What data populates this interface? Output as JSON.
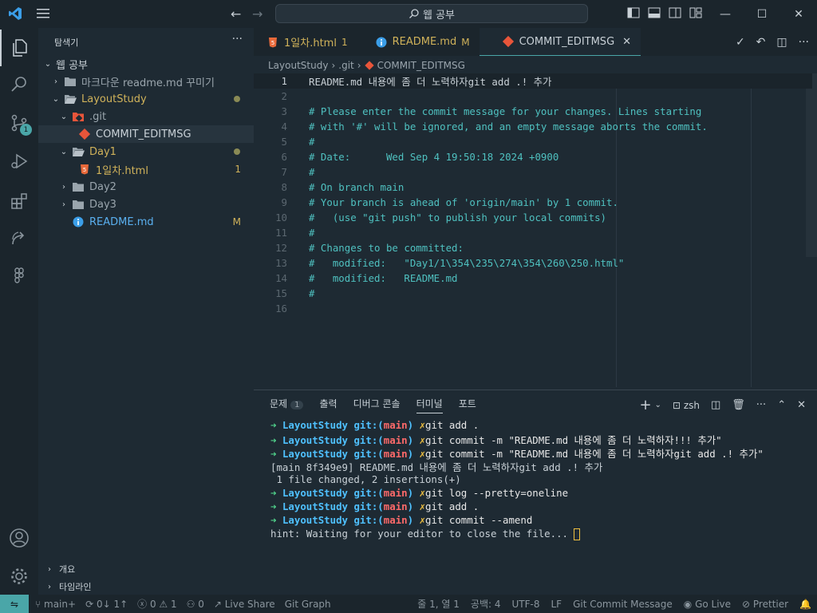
{
  "title_bar": {
    "search": "웹 공부"
  },
  "sidebar": {
    "title": "탐색기",
    "tree": [
      {
        "label": "웹 공부",
        "level": 0,
        "type": "root",
        "open": true
      },
      {
        "label": "마크다운 readme.md 꾸미기",
        "level": 1,
        "type": "folder",
        "open": false
      },
      {
        "label": "LayoutStudy",
        "level": 1,
        "type": "folder",
        "open": true
      },
      {
        "label": ".git",
        "level": 2,
        "type": "git",
        "open": true
      },
      {
        "label": "COMMIT_EDITMSG",
        "level": 3,
        "type": "gitfile"
      },
      {
        "label": "Day1",
        "level": 2,
        "type": "folder",
        "open": true
      },
      {
        "label": "1일차.html",
        "level": 3,
        "type": "html",
        "status": "1"
      },
      {
        "label": "Day2",
        "level": 2,
        "type": "folder",
        "open": false
      },
      {
        "label": "Day3",
        "level": 2,
        "type": "folder",
        "open": false
      },
      {
        "label": "README.md",
        "level": 2,
        "type": "info",
        "status": "M"
      }
    ],
    "outline": "개요",
    "timeline": "타임라인"
  },
  "activity_bar": {
    "scm_badge": "1"
  },
  "tabs": [
    {
      "label": "1일차.html",
      "status": "1",
      "active": false
    },
    {
      "label": "README.md",
      "status": "M",
      "active": false
    },
    {
      "label": "COMMIT_EDITMSG",
      "status": "",
      "active": true
    }
  ],
  "breadcrumb": [
    "LayoutStudy",
    ".git",
    "COMMIT_EDITMSG"
  ],
  "editor": {
    "lines": [
      "README.md 내용에 좀 더 노력하자git add .! 추가",
      "",
      "# Please enter the commit message for your changes. Lines starting",
      "# with '#' will be ignored, and an empty message aborts the commit.",
      "#",
      "# Date:      Wed Sep 4 19:50:18 2024 +0900",
      "#",
      "# On branch main",
      "# Your branch is ahead of 'origin/main' by 1 commit.",
      "#   (use \"git push\" to publish your local commits)",
      "#",
      "# Changes to be committed:",
      "#   modified:   \"Day1/1\\354\\235\\274\\354\\260\\250.html\"",
      "#   modified:   README.md",
      "#",
      ""
    ]
  },
  "panel": {
    "tabs": [
      "문제",
      "출력",
      "디버그 콘솔",
      "터미널",
      "포트"
    ],
    "problems_count": "1",
    "shell": "zsh",
    "terminal": {
      "prompt_dir": "LayoutStudy",
      "prompt_git": "git:(",
      "prompt_branch": "main",
      "prompt_close": ")",
      "arrow": "➜",
      "mark": "✗",
      "cmds": [
        "git add .",
        "git commit -m \"README.md 내용에 좀 더 노력하자!!! 추가\"",
        "git commit -m \"README.md 내용에 좀 더 노력하자git add .! 추가\""
      ],
      "out1": "[main 8f349e9] README.md 내용에 좀 더 노력하자git add .! 추가",
      "out2": " 1 file changed, 2 insertions(+)",
      "cmds2": [
        "git log --pretty=oneline",
        "git add .",
        "git commit --amend"
      ],
      "hint": "hint: Waiting for your editor to close the file... "
    }
  },
  "status_bar": {
    "branch": "main+",
    "sync": "0↓ 1↑",
    "errors": "0",
    "warnings": "1",
    "ports": "0",
    "live_share": "Live Share",
    "git_graph": "Git Graph",
    "position": "줄 1, 열 1",
    "spaces": "공백: 4",
    "encoding": "UTF-8",
    "eol": "LF",
    "language": "Git Commit Message",
    "go_live": "Go Live",
    "prettier": "Prettier"
  }
}
